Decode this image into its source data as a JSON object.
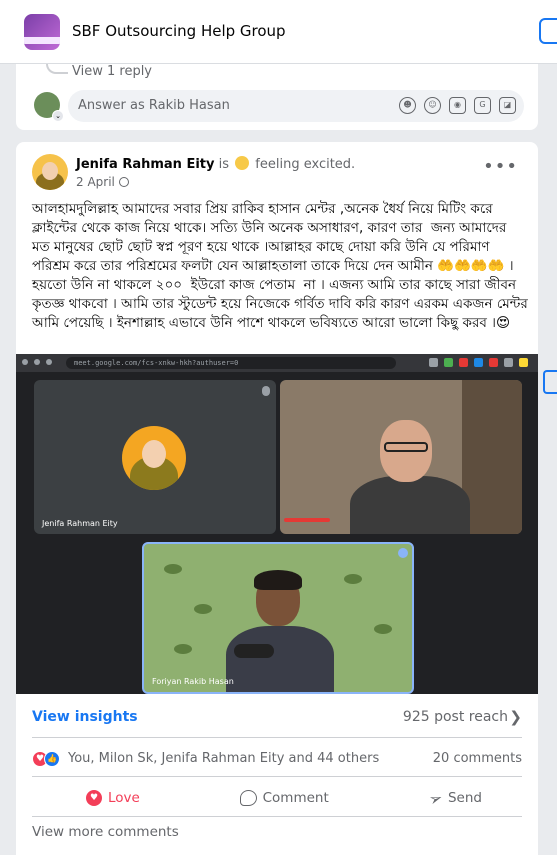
{
  "header": {
    "group_name": "SBF Outsourcing Help Group"
  },
  "previous_post": {
    "view_reply": "View 1 reply",
    "answer_placeholder": "Answer as Rakib Hasan",
    "composer_icons": [
      "avatar-sticker-icon",
      "emoji-icon",
      "camera-icon",
      "gif-icon",
      "sticker-icon"
    ]
  },
  "post": {
    "author": "Jenifa Rahman Eity",
    "feeling_prefix": "is",
    "feeling": "feeling excited.",
    "date": "2 April",
    "privacy_icon": "globe-icon",
    "text": "আলহামদুলিল্লাহ আমাদের সবার প্রিয় রাকিব হাসান মেন্টর ,অনেক ধৈর্য নিয়ে মিটিং করে ক্লাইন্টের থেকে কাজ নিয়ে থাকে। সত্যি উনি অনেক অসাধারণ, কারণ তার  জন্য আমাদের মত মানুষের ছোট ছোট স্বপ্ন পূরণ হয়ে থাকে ।আল্লাহর কাছে দোয়া করি উনি যে পরিমাণ পরিশ্রম করে তার পরিশ্রমের ফলটা যেন আল্লাহতালা তাকে দিয়ে দেন আমীন 🤲🤲🤲🤲 । হয়তো উনি না থাকলে ২০০  ইউরো কাজ পেতাম  না । এজন্য আমি তার কাছে সারা জীবন কৃতজ্ঞ থাকবো । আমি তার স্টুডেন্ট হয়ে নিজেকে গর্বিত দাবি করি কারণ এরকম একজন মেন্টর আমি পেয়েছি । ইনশাল্লাহ এভাবে উনি পাশে থাকলে ভবিষ্যতে আরো ভালো কিছু করব ।😍",
    "media": {
      "url": "meet.google.com/fcs-xnkw-hkh?authuser=0",
      "participants": [
        "Jenifa Rahman Eity",
        "",
        "Foriyan Rakib Hasan"
      ]
    },
    "insights_label": "View insights",
    "reach": "925 post reach",
    "reactors": "You, Milon Sk, Jenifa Rahman Eity and 44 others",
    "comments_count": "20 comments",
    "actions": {
      "love": "Love",
      "comment": "Comment",
      "send": "Send"
    },
    "view_more": "View more comments"
  },
  "colors": {
    "accent": "#1877f2",
    "love": "#f33e58",
    "muted": "#65676b",
    "background": "#e9ebee"
  }
}
